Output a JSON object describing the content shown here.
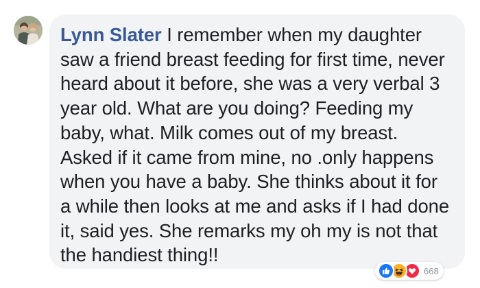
{
  "comment": {
    "author": "Lynn Slater",
    "text": "I remember when my daughter saw a friend breast feeding for first time, never heard about it before, she was a very verbal 3 year old. What are you doing? Feeding my baby, what. Milk comes out of my breast. Asked if it came from mine, no .only happens when you have a baby. She thinks about it for a while then looks at me and asks if I had done it, said yes. She remarks my oh my is not that the handiest thing!!",
    "avatar_icon": "profile-photo-avatar"
  },
  "reactions": {
    "icons": [
      "like-icon",
      "haha-icon",
      "love-icon"
    ],
    "count": "668"
  },
  "colors": {
    "author_name": "#385898",
    "bubble_bg": "#f2f3f5",
    "text": "#1c1e21",
    "like": "#1877f2",
    "haha": "#f7b125",
    "love": "#f0284a"
  }
}
